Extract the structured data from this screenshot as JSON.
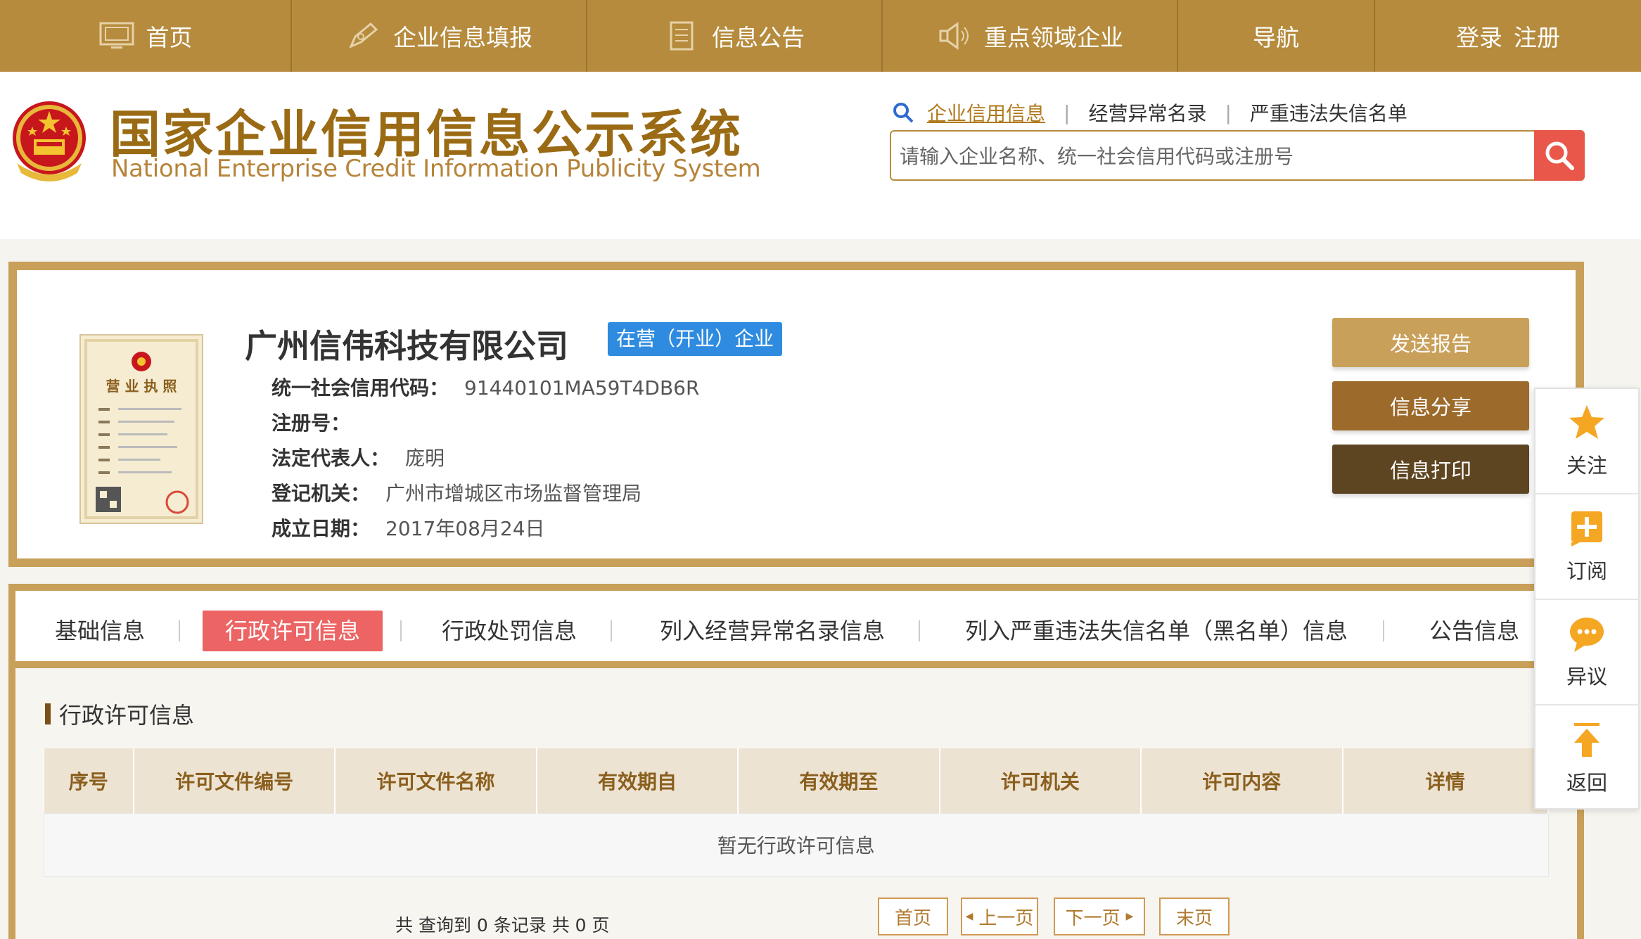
{
  "nav": [
    {
      "label": "首页",
      "icon": "monitor-icon"
    },
    {
      "label": "企业信息填报",
      "icon": "edit-icon"
    },
    {
      "label": "信息公告",
      "icon": "document-icon"
    },
    {
      "label": "重点领域企业",
      "icon": "speaker-icon"
    },
    {
      "label": "导航",
      "icon": ""
    },
    {
      "login": "登录",
      "register": "注册"
    }
  ],
  "header": {
    "title_cn": "国家企业信用信息公示系统",
    "title_en": "National Enterprise Credit Information Publicity System",
    "search_tabs": [
      "企业信用信息",
      "经营异常名录",
      "严重违法失信名单"
    ],
    "search_placeholder": "请输入企业名称、统一社会信用代码或注册号"
  },
  "company": {
    "name": "广州信伟科技有限公司",
    "status": "在营（开业）企业",
    "fields": [
      {
        "label": "统一社会信用代码：",
        "value": "91440101MA59T4DB6R"
      },
      {
        "label": "注册号：",
        "value": ""
      },
      {
        "label": "法定代表人：",
        "value": "庞明"
      },
      {
        "label": "登记机关：",
        "value": "广州市增城区市场监督管理局"
      },
      {
        "label": "成立日期：",
        "value": "2017年08月24日"
      }
    ],
    "license_title": "营 业 执 照",
    "actions": [
      "发送报告",
      "信息分享",
      "信息打印"
    ]
  },
  "tabs": [
    "基础信息",
    "行政许可信息",
    "行政处罚信息",
    "列入经营异常名录信息",
    "列入严重违法失信名单（黑名单）信息",
    "公告信息"
  ],
  "section": {
    "title": "行政许可信息",
    "columns": [
      "序号",
      "许可文件编号",
      "许可文件名称",
      "有效期自",
      "有效期至",
      "许可机关",
      "许可内容",
      "详情"
    ],
    "empty_text": "暂无行政许可信息"
  },
  "pager": {
    "info": "共 查询到 0 条记录 共 0 页",
    "first": "首页",
    "prev": "上一页",
    "next": "下一页",
    "last": "末页"
  },
  "side": [
    "关注",
    "订阅",
    "异议",
    "返回"
  ],
  "colors": {
    "nav_bg": "#b68b3d",
    "title": "#9a6b14",
    "badge": "#2e8be0",
    "active_tab": "#ec6464",
    "btn_report": "#c9a05a",
    "btn_share": "#9c6a2a",
    "btn_print": "#5e4521"
  }
}
